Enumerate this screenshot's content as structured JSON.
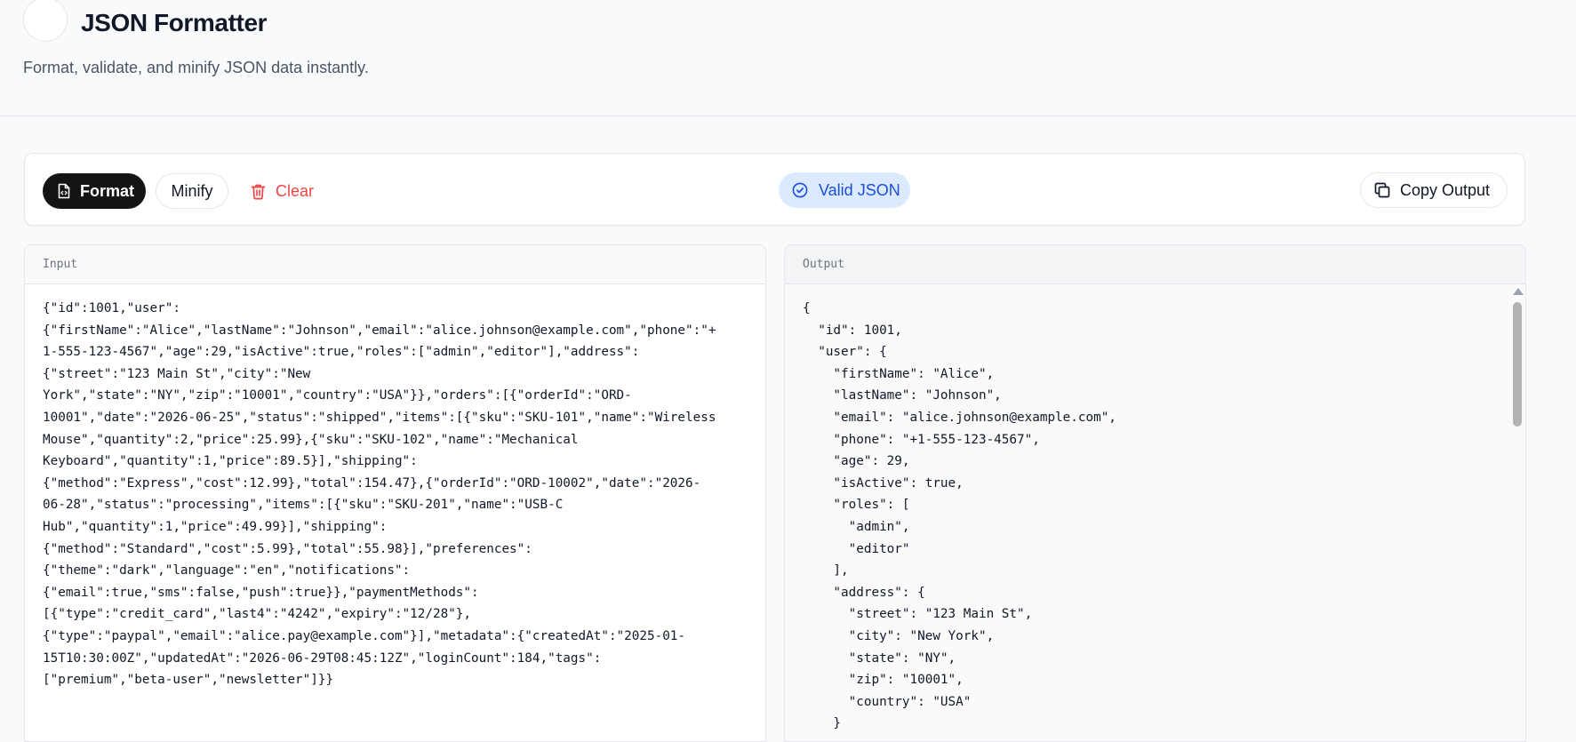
{
  "header": {
    "title": "JSON Formatter",
    "subtitle": "Format, validate, and minify JSON data instantly."
  },
  "toolbar": {
    "format_label": "Format",
    "minify_label": "Minify",
    "clear_label": "Clear",
    "status_label": "Valid JSON",
    "copy_label": "Copy Output"
  },
  "colors": {
    "primary_button": "#141414",
    "danger": "#ef4444",
    "valid_badge_bg": "#dbeafe",
    "valid_badge_text": "#1d4ed8"
  },
  "icons": {
    "format": "file-code-icon",
    "clear": "trash-icon",
    "status": "check-circle-icon",
    "copy": "copy-icon"
  },
  "input": {
    "label": "Input",
    "lines": [
      "{\"id\":1001,\"user\":",
      "{\"firstName\":\"Alice\",\"lastName\":\"Johnson\",\"email\":\"alice.johnson@example.com\",\"phone\":\"+",
      "1-555-123-4567\",\"age\":29,\"isActive\":true,\"roles\":[\"admin\",\"editor\"],\"address\":",
      "{\"street\":\"123 Main St\",\"city\":\"New",
      "York\",\"state\":\"NY\",\"zip\":\"10001\",\"country\":\"USA\"}},\"orders\":[{\"orderId\":\"ORD-",
      "10001\",\"date\":\"2026-06-25\",\"status\":\"shipped\",\"items\":[{\"sku\":\"SKU-101\",\"name\":\"Wireless",
      "Mouse\",\"quantity\":2,\"price\":25.99},{\"sku\":\"SKU-102\",\"name\":\"Mechanical",
      "Keyboard\",\"quantity\":1,\"price\":89.5}],\"shipping\":",
      "{\"method\":\"Express\",\"cost\":12.99},\"total\":154.47},{\"orderId\":\"ORD-10002\",\"date\":\"2026-",
      "06-28\",\"status\":\"processing\",\"items\":[{\"sku\":\"SKU-201\",\"name\":\"USB-C",
      "Hub\",\"quantity\":1,\"price\":49.99}],\"shipping\":",
      "{\"method\":\"Standard\",\"cost\":5.99},\"total\":55.98}],\"preferences\":",
      "{\"theme\":\"dark\",\"language\":\"en\",\"notifications\":",
      "{\"email\":true,\"sms\":false,\"push\":true}},\"paymentMethods\":",
      "[{\"type\":\"credit_card\",\"last4\":\"4242\",\"expiry\":\"12/28\"},",
      "{\"type\":\"paypal\",\"email\":\"alice.pay@example.com\"}],\"metadata\":{\"createdAt\":\"2025-01-",
      "15T10:30:00Z\",\"updatedAt\":\"2026-06-29T08:45:12Z\",\"loginCount\":184,\"tags\":",
      "[\"premium\",\"beta-user\",\"newsletter\"]}}"
    ]
  },
  "output": {
    "label": "Output",
    "lines": [
      "{",
      "  \"id\": 1001,",
      "  \"user\": {",
      "    \"firstName\": \"Alice\",",
      "    \"lastName\": \"Johnson\",",
      "    \"email\": \"alice.johnson@example.com\",",
      "    \"phone\": \"+1-555-123-4567\",",
      "    \"age\": 29,",
      "    \"isActive\": true,",
      "    \"roles\": [",
      "      \"admin\",",
      "      \"editor\"",
      "    ],",
      "    \"address\": {",
      "      \"street\": \"123 Main St\",",
      "      \"city\": \"New York\",",
      "      \"state\": \"NY\",",
      "      \"zip\": \"10001\",",
      "      \"country\": \"USA\"",
      "    }"
    ]
  }
}
